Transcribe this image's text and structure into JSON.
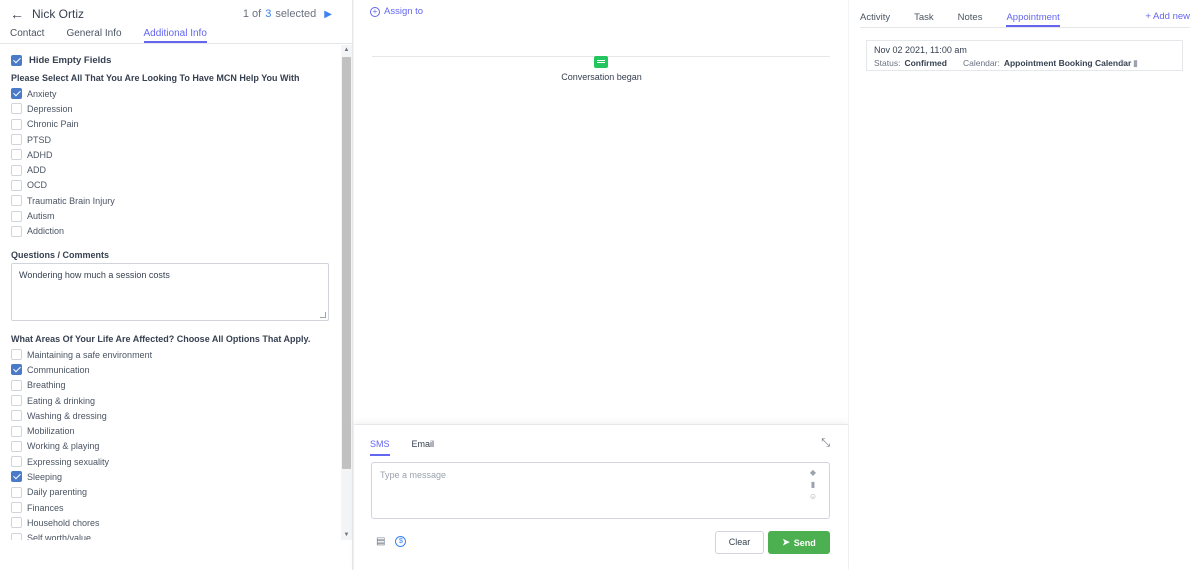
{
  "header": {
    "back_icon": "arrow-left-icon",
    "contact_name": "Nick Ortiz",
    "pager_current": "1 of",
    "pager_total": "3",
    "pager_selected": "selected"
  },
  "left_tabs": [
    "Contact",
    "General Info",
    "Additional Info"
  ],
  "hide_empty": {
    "label": "Hide Empty Fields",
    "checked": true
  },
  "section1": {
    "title": "Please Select All That You Are Looking To Have MCN Help You With",
    "options": [
      {
        "label": "Anxiety",
        "checked": true
      },
      {
        "label": "Depression",
        "checked": false
      },
      {
        "label": "Chronic Pain",
        "checked": false
      },
      {
        "label": "PTSD",
        "checked": false
      },
      {
        "label": "ADHD",
        "checked": false
      },
      {
        "label": "ADD",
        "checked": false
      },
      {
        "label": "OCD",
        "checked": false
      },
      {
        "label": "Traumatic Brain Injury",
        "checked": false
      },
      {
        "label": "Autism",
        "checked": false
      },
      {
        "label": "Addiction",
        "checked": false
      }
    ]
  },
  "questions": {
    "title": "Questions / Comments",
    "value": "Wondering how much a session costs"
  },
  "section2": {
    "title": "What Areas Of Your Life Are Affected? Choose All Options That Apply.",
    "options": [
      {
        "label": "Maintaining a safe environment",
        "checked": false
      },
      {
        "label": "Communication",
        "checked": true
      },
      {
        "label": "Breathing",
        "checked": false
      },
      {
        "label": "Eating & drinking",
        "checked": false
      },
      {
        "label": "Washing & dressing",
        "checked": false
      },
      {
        "label": "Mobilization",
        "checked": false
      },
      {
        "label": "Working & playing",
        "checked": false
      },
      {
        "label": "Expressing sexuality",
        "checked": false
      },
      {
        "label": "Sleeping",
        "checked": true
      },
      {
        "label": "Daily parenting",
        "checked": false
      },
      {
        "label": "Finances",
        "checked": false
      },
      {
        "label": "Household chores",
        "checked": false
      },
      {
        "label": "Self worth/value",
        "checked": false
      }
    ]
  },
  "middle": {
    "assign_label": "Assign to",
    "conversation_label": "Conversation began"
  },
  "composer": {
    "tabs": [
      "SMS",
      "Email"
    ],
    "placeholder": "Type a message",
    "clear_label": "Clear",
    "send_label": "Send"
  },
  "right_tabs": [
    "Activity",
    "Task",
    "Notes",
    "Appointment"
  ],
  "add_new_label": "+ Add new",
  "appointment": {
    "datetime": "Nov 02 2021, 11:00 am",
    "status_label": "Status:",
    "status_value": "Confirmed",
    "calendar_label": "Calendar:",
    "calendar_value": "Appointment Booking Calendar"
  },
  "colors": {
    "accent": "#6366f1",
    "checkbox_on": "#4a7bc8",
    "send_button": "#4caf50",
    "conversation_icon": "#22c55e"
  }
}
